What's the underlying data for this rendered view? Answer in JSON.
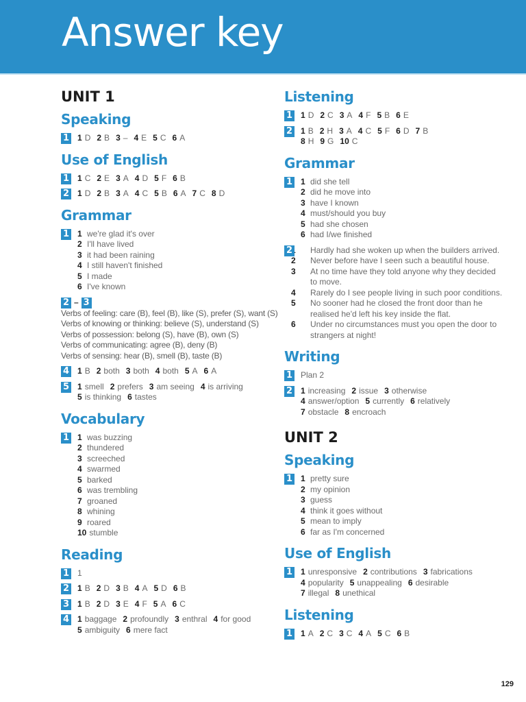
{
  "header": {
    "title": "Answer key"
  },
  "page_number": "129",
  "accent_color": "#2a8fc9",
  "left_column": {
    "unit1_title": "UNIT 1",
    "speaking": {
      "title": "Speaking",
      "ex1": {
        "badge": "1",
        "answers": [
          [
            "1",
            "D"
          ],
          [
            "2",
            "B"
          ],
          [
            "3",
            "–"
          ],
          [
            "4",
            "E"
          ],
          [
            "5",
            "C"
          ],
          [
            "6",
            "A"
          ]
        ]
      }
    },
    "use_of_english": {
      "title": "Use of English",
      "ex1": {
        "badge": "1",
        "answers": [
          [
            "1",
            "C"
          ],
          [
            "2",
            "E"
          ],
          [
            "3",
            "A"
          ],
          [
            "4",
            "D"
          ],
          [
            "5",
            "F"
          ],
          [
            "6",
            "B"
          ]
        ]
      },
      "ex2": {
        "badge": "2",
        "answers": [
          [
            "1",
            "D"
          ],
          [
            "2",
            "B"
          ],
          [
            "3",
            "A"
          ],
          [
            "4",
            "C"
          ],
          [
            "5",
            "B"
          ],
          [
            "6",
            "A"
          ],
          [
            "7",
            "C"
          ],
          [
            "8",
            "D"
          ]
        ]
      }
    },
    "grammar": {
      "title": "Grammar",
      "ex1": {
        "badge": "1",
        "answers": [
          [
            "1",
            "we're glad it's over"
          ],
          [
            "2",
            "I'll have lived"
          ],
          [
            "3",
            "it had been raining"
          ],
          [
            "4",
            "I still haven't finished"
          ],
          [
            "5",
            "I made"
          ],
          [
            "6",
            "I've known"
          ]
        ]
      },
      "ex23": {
        "badge_a": "2",
        "dash": "–",
        "badge_b": "3",
        "lines": [
          "Verbs of feeling: care (B), feel (B), like (S), prefer (S), want (S)",
          "Verbs of knowing or thinking: believe (S), understand (S)",
          "Verbs of possession: belong (S), have (B), own (S)",
          "Verbs of communicating: agree (B), deny (B)",
          "Verbs of sensing: hear (B), smell (B), taste (B)"
        ]
      },
      "ex4": {
        "badge": "4",
        "answers": [
          [
            "1",
            "B"
          ],
          [
            "2",
            "both"
          ],
          [
            "3",
            "both"
          ],
          [
            "4",
            "both"
          ],
          [
            "5",
            "A"
          ],
          [
            "6",
            "A"
          ]
        ]
      },
      "ex5": {
        "badge": "5",
        "line1": [
          [
            "1",
            "smell"
          ],
          [
            "2",
            "prefers"
          ],
          [
            "3",
            "am seeing"
          ],
          [
            "4",
            "is arriving"
          ]
        ],
        "line2": [
          [
            "5",
            "is thinking"
          ],
          [
            "6",
            "tastes"
          ]
        ]
      }
    },
    "vocabulary": {
      "title": "Vocabulary",
      "ex1": {
        "badge": "1",
        "answers": [
          [
            "1",
            "was buzzing"
          ],
          [
            "2",
            "thundered"
          ],
          [
            "3",
            "screeched"
          ],
          [
            "4",
            "swarmed"
          ],
          [
            "5",
            "barked"
          ],
          [
            "6",
            "was trembling"
          ],
          [
            "7",
            "groaned"
          ],
          [
            "8",
            "whining"
          ],
          [
            "9",
            "roared"
          ],
          [
            "10",
            "stumble"
          ]
        ]
      }
    },
    "reading": {
      "title": "Reading",
      "ex1": {
        "badge": "1",
        "text": "1"
      },
      "ex2": {
        "badge": "2",
        "answers": [
          [
            "1",
            "B"
          ],
          [
            "2",
            "D"
          ],
          [
            "3",
            "B"
          ],
          [
            "4",
            "A"
          ],
          [
            "5",
            "D"
          ],
          [
            "6",
            "B"
          ]
        ]
      },
      "ex3": {
        "badge": "3",
        "answers": [
          [
            "1",
            "B"
          ],
          [
            "2",
            "D"
          ],
          [
            "3",
            "E"
          ],
          [
            "4",
            "F"
          ],
          [
            "5",
            "A"
          ],
          [
            "6",
            "C"
          ]
        ]
      },
      "ex4": {
        "badge": "4",
        "line1": [
          [
            "1",
            "baggage"
          ],
          [
            "2",
            "profoundly"
          ],
          [
            "3",
            "enthral"
          ],
          [
            "4",
            "for good"
          ]
        ],
        "line2": [
          [
            "5",
            "ambiguity"
          ],
          [
            "6",
            "mere fact"
          ]
        ]
      }
    }
  },
  "right_column": {
    "listening": {
      "title": "Listening",
      "ex1": {
        "badge": "1",
        "answers": [
          [
            "1",
            "D"
          ],
          [
            "2",
            "C"
          ],
          [
            "3",
            "A"
          ],
          [
            "4",
            "F"
          ],
          [
            "5",
            "B"
          ],
          [
            "6",
            "E"
          ]
        ]
      },
      "ex2": {
        "badge": "2",
        "line1": [
          [
            "1",
            "B"
          ],
          [
            "2",
            "H"
          ],
          [
            "3",
            "A"
          ],
          [
            "4",
            "C"
          ],
          [
            "5",
            "F"
          ],
          [
            "6",
            "D"
          ],
          [
            "7",
            "B"
          ]
        ],
        "line2": [
          [
            "8",
            "H"
          ],
          [
            "9",
            "G"
          ],
          [
            "10",
            "C"
          ]
        ]
      }
    },
    "grammar": {
      "title": "Grammar",
      "ex1": {
        "badge": "1",
        "answers": [
          [
            "1",
            "did she tell"
          ],
          [
            "2",
            "did he move into"
          ],
          [
            "3",
            "have I known"
          ],
          [
            "4",
            "must/should you buy"
          ],
          [
            "5",
            "had she chosen"
          ],
          [
            "6",
            "had I/we finished"
          ]
        ]
      },
      "ex2": {
        "badge": "2",
        "answers": [
          [
            "1",
            "Hardly had she woken up when the builders arrived."
          ],
          [
            "2",
            "Never before have I seen such a beautiful house."
          ],
          [
            "3",
            "At no time have they told anyone why they decided to move."
          ],
          [
            "4",
            "Rarely do I see people living in such poor conditions."
          ],
          [
            "5",
            "No sooner had he closed the front door than he realised he'd left his key inside the flat."
          ],
          [
            "6",
            "Under no circumstances must you open the door to strangers at night!"
          ]
        ]
      }
    },
    "writing": {
      "title": "Writing",
      "ex1": {
        "badge": "1",
        "text": "Plan 2"
      },
      "ex2": {
        "badge": "2",
        "line1": [
          [
            "1",
            "increasing"
          ],
          [
            "2",
            "issue"
          ],
          [
            "3",
            "otherwise"
          ]
        ],
        "line2": [
          [
            "4",
            "answer/option"
          ],
          [
            "5",
            "currently"
          ],
          [
            "6",
            "relatively"
          ]
        ],
        "line3": [
          [
            "7",
            "obstacle"
          ],
          [
            "8",
            "encroach"
          ]
        ]
      }
    },
    "unit2_title": "UNIT 2",
    "speaking": {
      "title": "Speaking",
      "ex1": {
        "badge": "1",
        "answers": [
          [
            "1",
            "pretty sure"
          ],
          [
            "2",
            "my opinion"
          ],
          [
            "3",
            "guess"
          ],
          [
            "4",
            "think it goes without"
          ],
          [
            "5",
            "mean to imply"
          ],
          [
            "6",
            "far as I'm concerned"
          ]
        ]
      }
    },
    "use_of_english": {
      "title": "Use of English",
      "ex1": {
        "badge": "1",
        "line1": [
          [
            "1",
            "unresponsive"
          ],
          [
            "2",
            "contributions"
          ],
          [
            "3",
            "fabrications"
          ]
        ],
        "line2": [
          [
            "4",
            "popularity"
          ],
          [
            "5",
            "unappealing"
          ],
          [
            "6",
            "desirable"
          ]
        ],
        "line3": [
          [
            "7",
            "illegal"
          ],
          [
            "8",
            "unethical"
          ]
        ]
      }
    },
    "listening2": {
      "title": "Listening",
      "ex1": {
        "badge": "1",
        "answers": [
          [
            "1",
            "A"
          ],
          [
            "2",
            "C"
          ],
          [
            "3",
            "C"
          ],
          [
            "4",
            "A"
          ],
          [
            "5",
            "C"
          ],
          [
            "6",
            "B"
          ]
        ]
      }
    }
  }
}
